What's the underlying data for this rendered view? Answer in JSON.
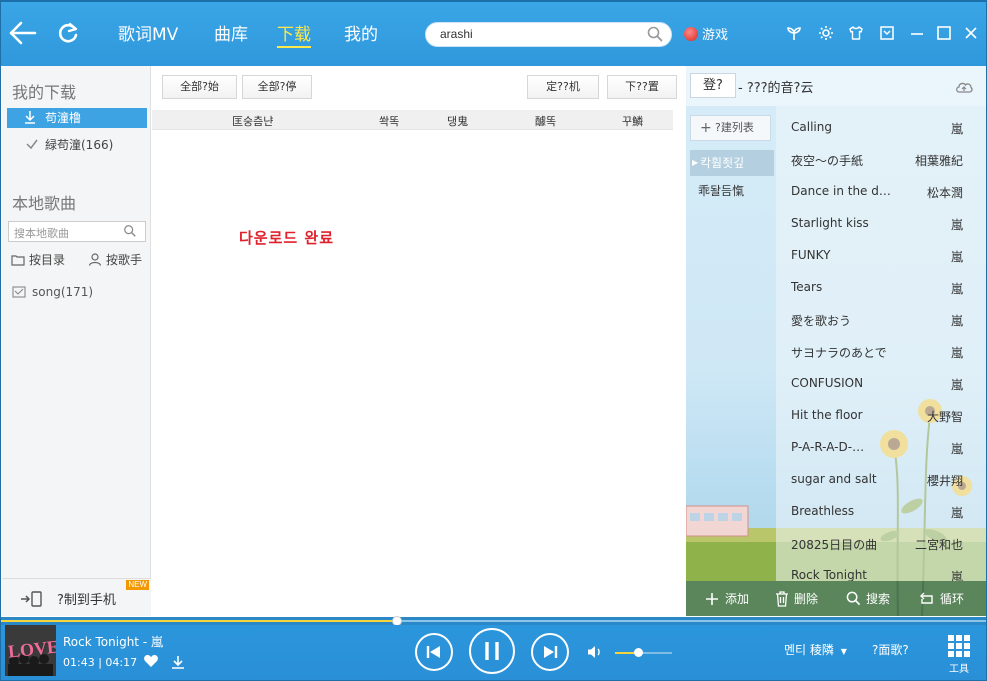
{
  "topbar": {
    "tabs": [
      {
        "label": "歌词MV",
        "active": false
      },
      {
        "label": "曲库",
        "active": false
      },
      {
        "label": "下载",
        "active": true
      },
      {
        "label": "我的",
        "active": false
      }
    ],
    "search": {
      "value": "arashi"
    },
    "game_label": "游戏",
    "accent": "#ffe94a",
    "bg_color": "#3aa6e6"
  },
  "left": {
    "my_downloads_title": "我的下载",
    "downloading_label": "苟潼橹",
    "downloaded_label": "緑苟潼(166)",
    "local_title": "本地歌曲",
    "local_search_placeholder": "搜本地歌曲",
    "by_folder_label": "按目录",
    "by_artist_label": "按歌手",
    "song_folder_label": "song(171)",
    "sync_phone_label": "?制到手机",
    "new_badge": "NEW"
  },
  "center": {
    "buttons": [
      "全部?始",
      "全部?停",
      "定??机",
      "下??置"
    ],
    "columns": [
      "匡숭츰냔",
      "쏵똑",
      "댕鬼",
      "醵똑",
      "꾸鱗"
    ],
    "complete_text": "다운로드 완료"
  },
  "right": {
    "login_label": "登?",
    "cloud_title": "- ???的音?云",
    "new_list_label": "?建列表",
    "lists": [
      "칵훰죗깊",
      "乖돨듬愾"
    ],
    "songs": [
      {
        "title": "Calling",
        "artist": "嵐"
      },
      {
        "title": "夜空～の手紙",
        "artist": "相葉雅紀"
      },
      {
        "title": "Dance in the d…",
        "artist": "松本潤"
      },
      {
        "title": "Starlight kiss",
        "artist": "嵐"
      },
      {
        "title": "FUNKY",
        "artist": "嵐"
      },
      {
        "title": "Tears",
        "artist": "嵐"
      },
      {
        "title": "愛を歌おう",
        "artist": "嵐"
      },
      {
        "title": "サヨナラのあとで",
        "artist": "嵐"
      },
      {
        "title": "CONFUSION",
        "artist": "嵐"
      },
      {
        "title": "Hit the floor",
        "artist": "大野智"
      },
      {
        "title": "P-A-R-A-D-…",
        "artist": "嵐"
      },
      {
        "title": "sugar and salt",
        "artist": "櫻井翔"
      },
      {
        "title": "Breathless",
        "artist": "嵐"
      },
      {
        "title": "20825日目の曲",
        "artist": "二宮和也"
      },
      {
        "title": "Rock Tonight",
        "artist": "嵐"
      }
    ],
    "tools": [
      "添加",
      "删除",
      "搜索",
      "循环"
    ]
  },
  "player": {
    "cover_text": "LOVE",
    "title": "Rock Tonight - 嵐",
    "time": "01:43 | 04:17",
    "progress_fraction": 0.402,
    "volume_fraction": 0.4,
    "mode_label": "멘티 稜隣",
    "question_label": "?面歌?",
    "tools_label": "工具"
  }
}
